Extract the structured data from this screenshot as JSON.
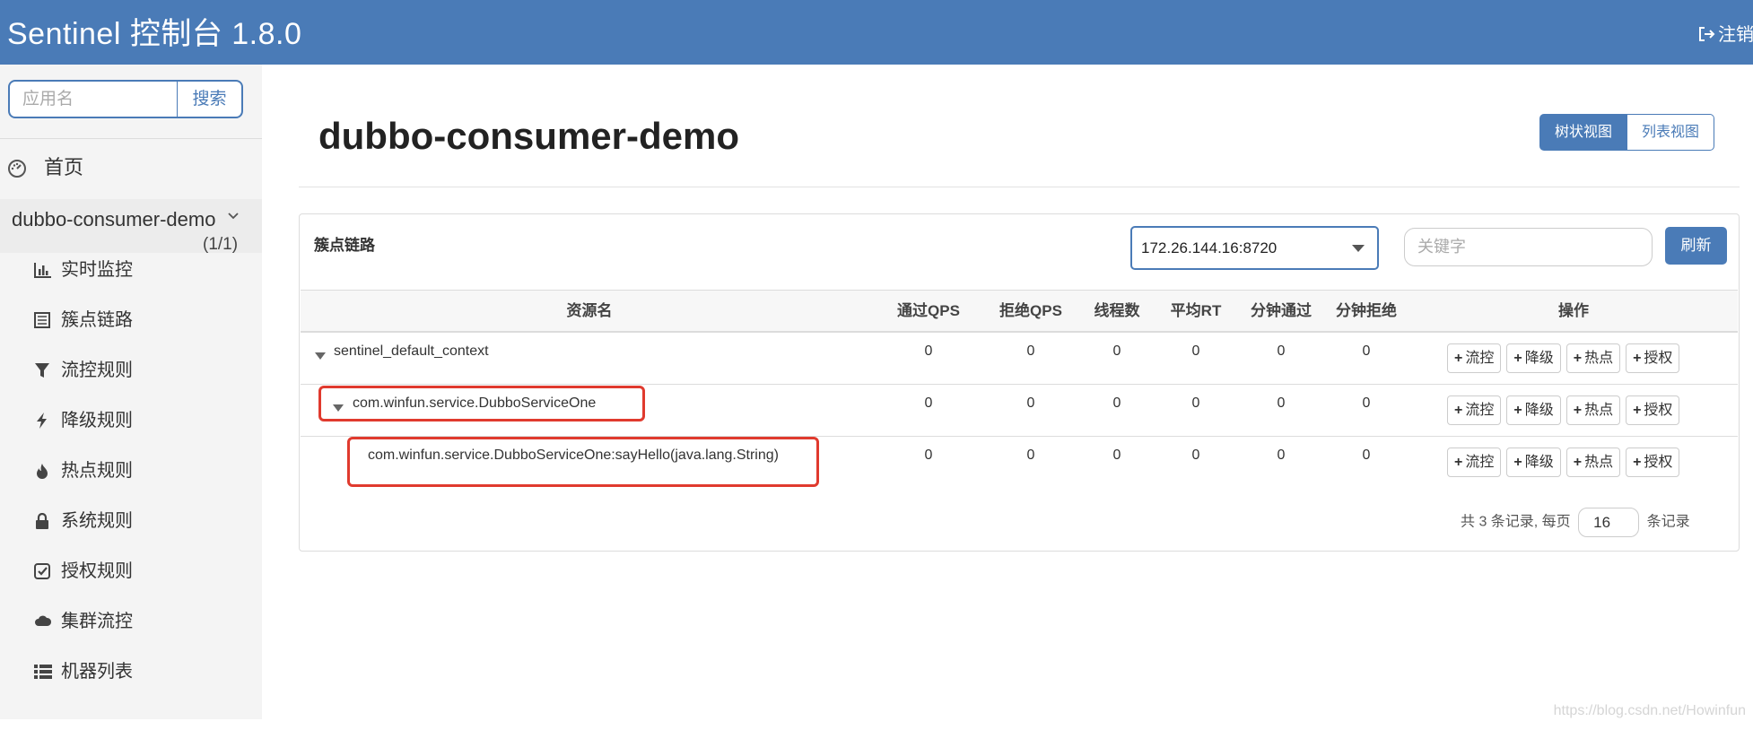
{
  "header": {
    "title": "Sentinel 控制台 1.8.0",
    "logout_label": "注销"
  },
  "sidebar": {
    "search_placeholder": "应用名",
    "search_button": "搜索",
    "home_label": "首页",
    "app": {
      "name": "dubbo-consumer-demo",
      "count": "(1/1)"
    },
    "menu": [
      {
        "label": "实时监控",
        "icon": "bar-chart-icon"
      },
      {
        "label": "簇点链路",
        "icon": "list-alt-icon"
      },
      {
        "label": "流控规则",
        "icon": "filter-icon"
      },
      {
        "label": "降级规则",
        "icon": "flash-icon"
      },
      {
        "label": "热点规则",
        "icon": "fire-icon"
      },
      {
        "label": "系统规则",
        "icon": "lock-icon"
      },
      {
        "label": "授权规则",
        "icon": "check-icon"
      },
      {
        "label": "集群流控",
        "icon": "cloud-icon"
      },
      {
        "label": "机器列表",
        "icon": "th-list-icon"
      }
    ]
  },
  "main": {
    "page_title": "dubbo-consumer-demo",
    "view_buttons": {
      "tree": "树状视图",
      "list": "列表视图"
    },
    "panel": {
      "heading": "簇点链路",
      "machine": "172.26.144.16:8720",
      "keyword_placeholder": "关键字",
      "refresh": "刷新"
    },
    "table": {
      "columns": [
        "资源名",
        "通过QPS",
        "拒绝QPS",
        "线程数",
        "平均RT",
        "分钟通过",
        "分钟拒绝",
        "操作"
      ],
      "rows": [
        {
          "name": "sentinel_default_context",
          "values": [
            "0",
            "0",
            "0",
            "0",
            "0",
            "0"
          ]
        },
        {
          "name": "com.winfun.service.DubboServiceOne",
          "values": [
            "0",
            "0",
            "0",
            "0",
            "0",
            "0"
          ]
        },
        {
          "name": "com.winfun.service.DubboServiceOne:sayHello(java.lang.String)",
          "values": [
            "0",
            "0",
            "0",
            "0",
            "0",
            "0"
          ]
        }
      ],
      "actions": [
        "流控",
        "降级",
        "热点",
        "授权"
      ],
      "action_icon": "+"
    },
    "pager": {
      "prefix": "共 3 条记录, 每页",
      "page_size": "16",
      "suffix": "条记录"
    }
  },
  "watermark": "https://blog.csdn.net/Howinfun",
  "colors": {
    "brand": "#4a7bb7",
    "highlight": "#e03a2e"
  }
}
